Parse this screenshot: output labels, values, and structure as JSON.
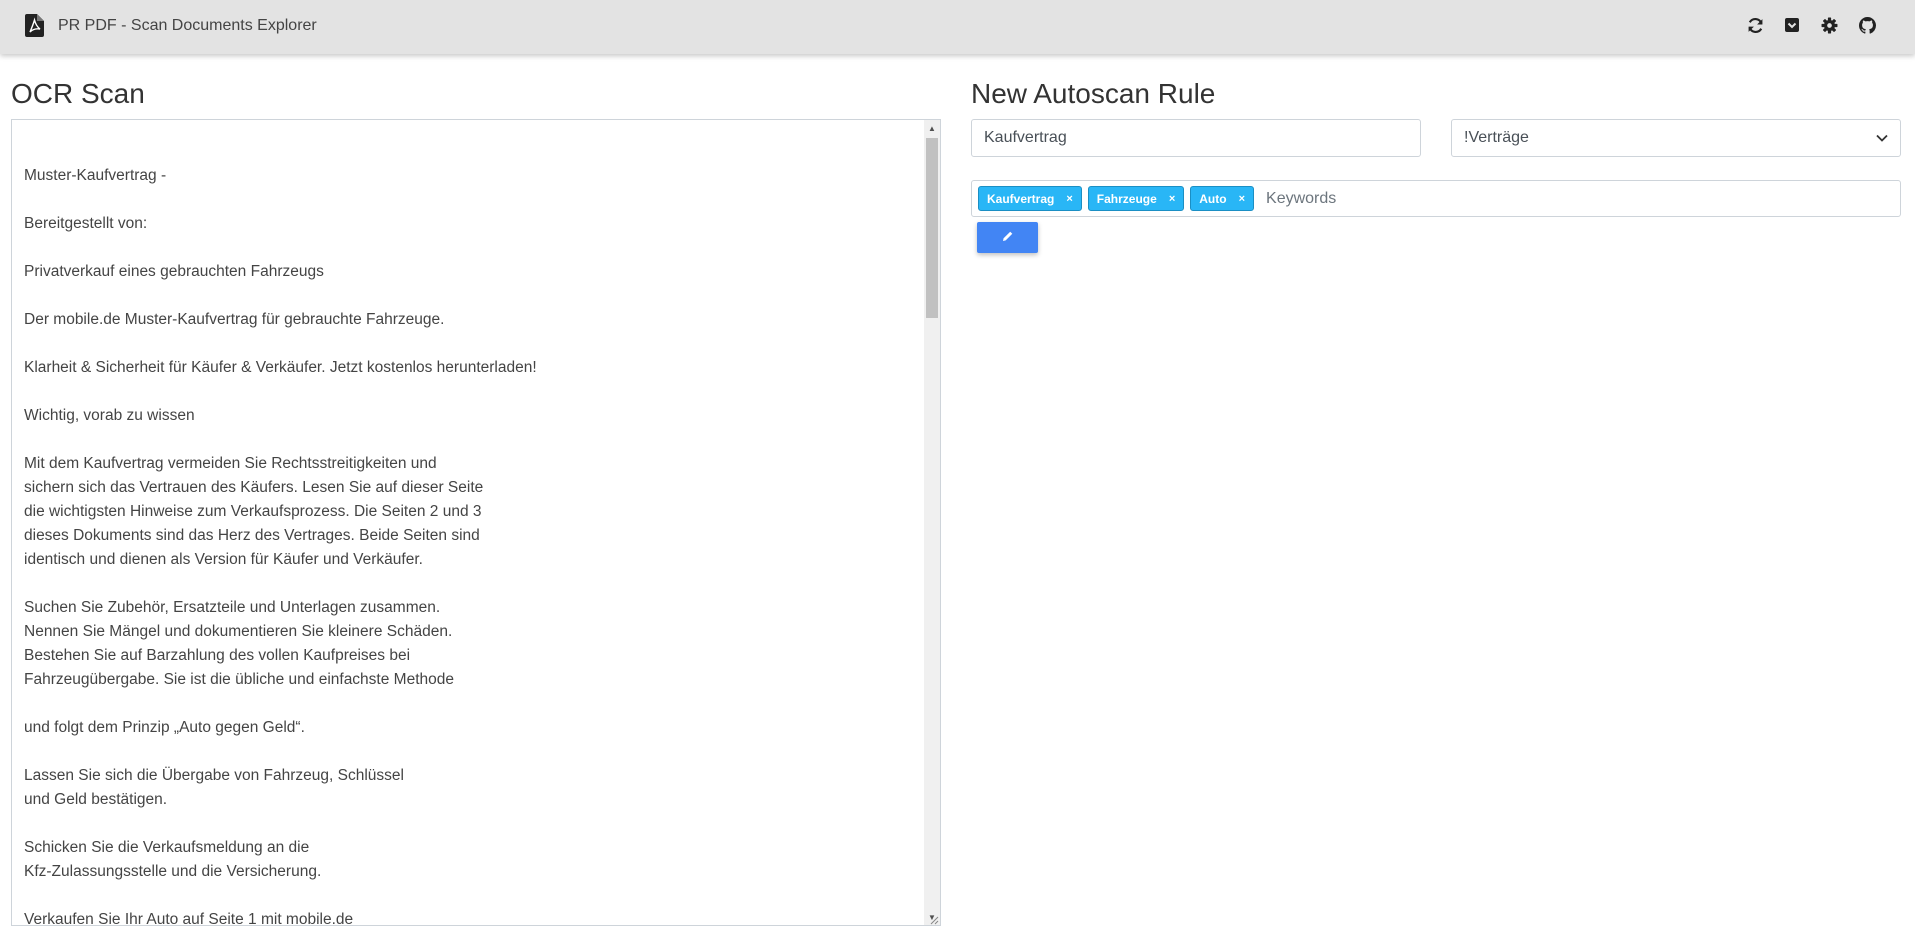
{
  "app": {
    "title": "PR PDF - Scan Documents Explorer",
    "icons": [
      "pdf-file-icon",
      "refresh-icon",
      "inbox-icon",
      "settings-gear-icon",
      "github-icon"
    ]
  },
  "ocr": {
    "heading": "OCR Scan",
    "text": "\nMuster-Kaufvertrag -\n\nBereitgestellt von:\n\nPrivatverkauf eines gebrauchten Fahrzeugs\n\nDer mobile.de Muster-Kaufvertrag für gebrauchte Fahrzeuge.\n\nKlarheit & Sicherheit für Käufer & Verkäufer. Jetzt kostenlos herunterladen!\n\nWichtig, vorab zu wissen\n\nMit dem Kaufvertrag vermeiden Sie Rechtsstreitigkeiten und\nsichern sich das Vertrauen des Käufers. Lesen Sie auf dieser Seite\ndie wichtigsten Hinweise zum Verkaufsprozess. Die Seiten 2 und 3\ndieses Dokuments sind das Herz des Vertrages. Beide Seiten sind\nidentisch und dienen als Version für Käufer und Verkäufer.\n\nSuchen Sie Zubehör, Ersatzteile und Unterlagen zusammen.\nNennen Sie Mängel und dokumentieren Sie kleinere Schäden.\nBestehen Sie auf Barzahlung des vollen Kaufpreises bei\nFahrzeugübergabe. Sie ist die übliche und einfachste Methode\n\nund folgt dem Prinzip „Auto gegen Geld“.\n\nLassen Sie sich die Übergabe von Fahrzeug, Schlüssel\nund Geld bestätigen.\n\nSchicken Sie die Verkaufsmeldung an die\nKfz-Zulassungsstelle und die Versicherung.\n\nVerkaufen Sie Ihr Auto auf Seite 1 mit mobile.de"
  },
  "rule": {
    "heading": "New Autoscan Rule",
    "name_value": "Kaufvertrag",
    "folder_selected": "!Verträge",
    "keywords": [
      "Kaufvertrag",
      "Fahrzeuge",
      "Auto"
    ],
    "keywords_placeholder": "Keywords",
    "tag_remove_glyph": "×"
  },
  "colors": {
    "topbar": "#e3e3e3",
    "tag": "#29b6f6",
    "button": "#4285f4"
  }
}
